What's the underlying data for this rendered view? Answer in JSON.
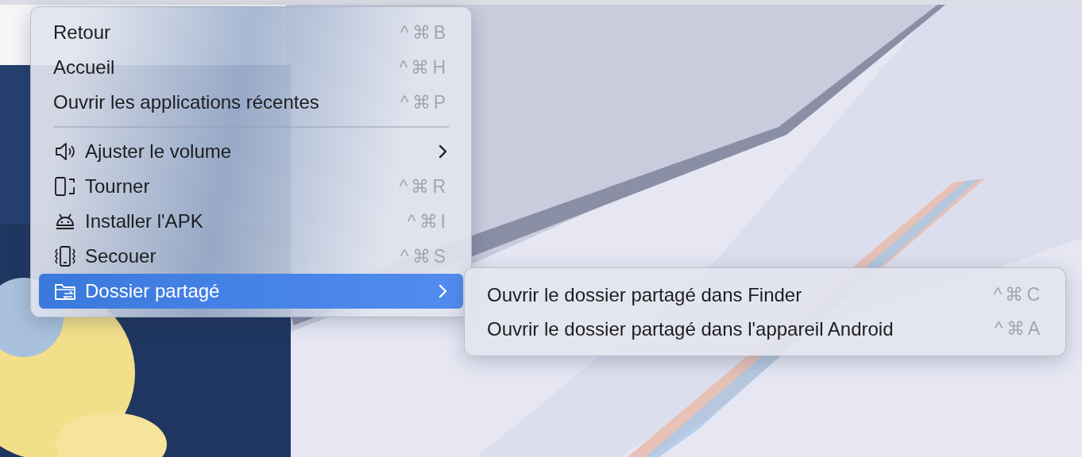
{
  "menu": {
    "items": [
      {
        "kind": "action",
        "label": "Retour",
        "shortcut": "^⌘B",
        "icon": false,
        "selected": false
      },
      {
        "kind": "action",
        "label": "Accueil",
        "shortcut": "^⌘H",
        "icon": false,
        "selected": false
      },
      {
        "kind": "action",
        "label": "Ouvrir les applications récentes",
        "shortcut": "^⌘P",
        "icon": false,
        "selected": false
      },
      {
        "kind": "separator"
      },
      {
        "kind": "submenu",
        "label": "Ajuster le volume",
        "icon": true,
        "selected": false
      },
      {
        "kind": "action",
        "label": "Tourner",
        "shortcut": "^⌘R",
        "icon": true,
        "selected": false
      },
      {
        "kind": "action",
        "label": "Installer l'APK",
        "shortcut": "^⌘I",
        "icon": true,
        "selected": false
      },
      {
        "kind": "action",
        "label": "Secouer",
        "shortcut": "^⌘S",
        "icon": true,
        "selected": false
      },
      {
        "kind": "submenu",
        "label": "Dossier partagé",
        "icon": true,
        "selected": true
      }
    ]
  },
  "submenu": {
    "items": [
      {
        "label": "Ouvrir le dossier partagé dans Finder",
        "shortcut": "^⌘C",
        "selected": false
      },
      {
        "label": "Ouvrir le dossier partagé dans l'appareil Android",
        "shortcut": "^⌘A",
        "selected": false
      }
    ]
  }
}
